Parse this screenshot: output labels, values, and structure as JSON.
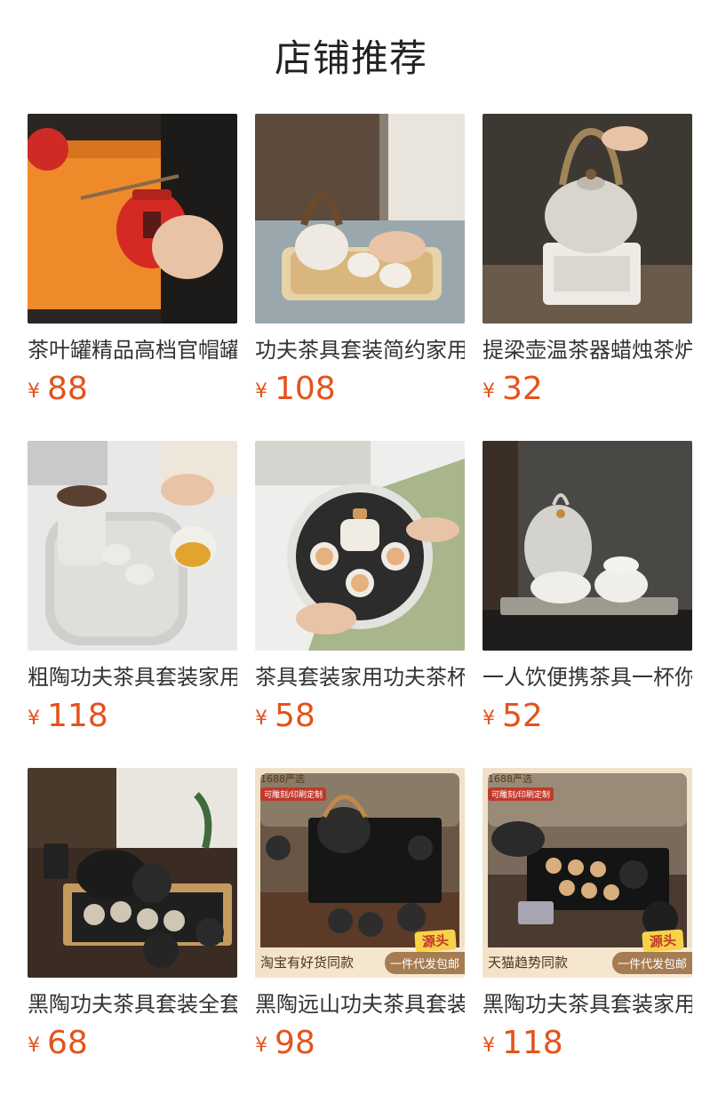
{
  "page": {
    "title": "店铺推荐"
  },
  "products": [
    {
      "name": "茶叶罐精品高档官帽罐",
      "currency": "¥",
      "price": "88",
      "image": "red-tea-caddy"
    },
    {
      "name": "功夫茶具套装简约家用",
      "currency": "¥",
      "price": "108",
      "image": "white-teapot-set"
    },
    {
      "name": "提梁壶温茶器蜡烛茶炉",
      "currency": "¥",
      "price": "32",
      "image": "teapot-warmer"
    },
    {
      "name": "粗陶功夫茶具套装家用",
      "currency": "¥",
      "price": "118",
      "image": "coarse-pottery-set"
    },
    {
      "name": "茶具套装家用功夫茶杯",
      "currency": "¥",
      "price": "58",
      "image": "round-tray-set"
    },
    {
      "name": "一人饮便携茶具一杯你",
      "currency": "¥",
      "price": "52",
      "image": "travel-tea-set"
    },
    {
      "name": "黑陶功夫茶具套装全套",
      "currency": "¥",
      "price": "68",
      "image": "black-pottery-set"
    },
    {
      "name": "黑陶远山功夫茶具套装",
      "currency": "¥",
      "price": "98",
      "image": "mountain-tea-set",
      "badges": {
        "top": "1688严选",
        "sub": "可雕刻/印刷定制",
        "bottom_left": "淘宝有好货同款",
        "source": "源头",
        "ship": "一件代发包邮"
      }
    },
    {
      "name": "黑陶功夫茶具套装家用",
      "currency": "¥",
      "price": "118",
      "image": "black-tray-set",
      "badges": {
        "top": "1688严选",
        "sub": "可雕刻/印刷定制",
        "bottom_left": "天猫趋势同款",
        "source": "源头",
        "ship": "一件代发包邮"
      }
    }
  ]
}
